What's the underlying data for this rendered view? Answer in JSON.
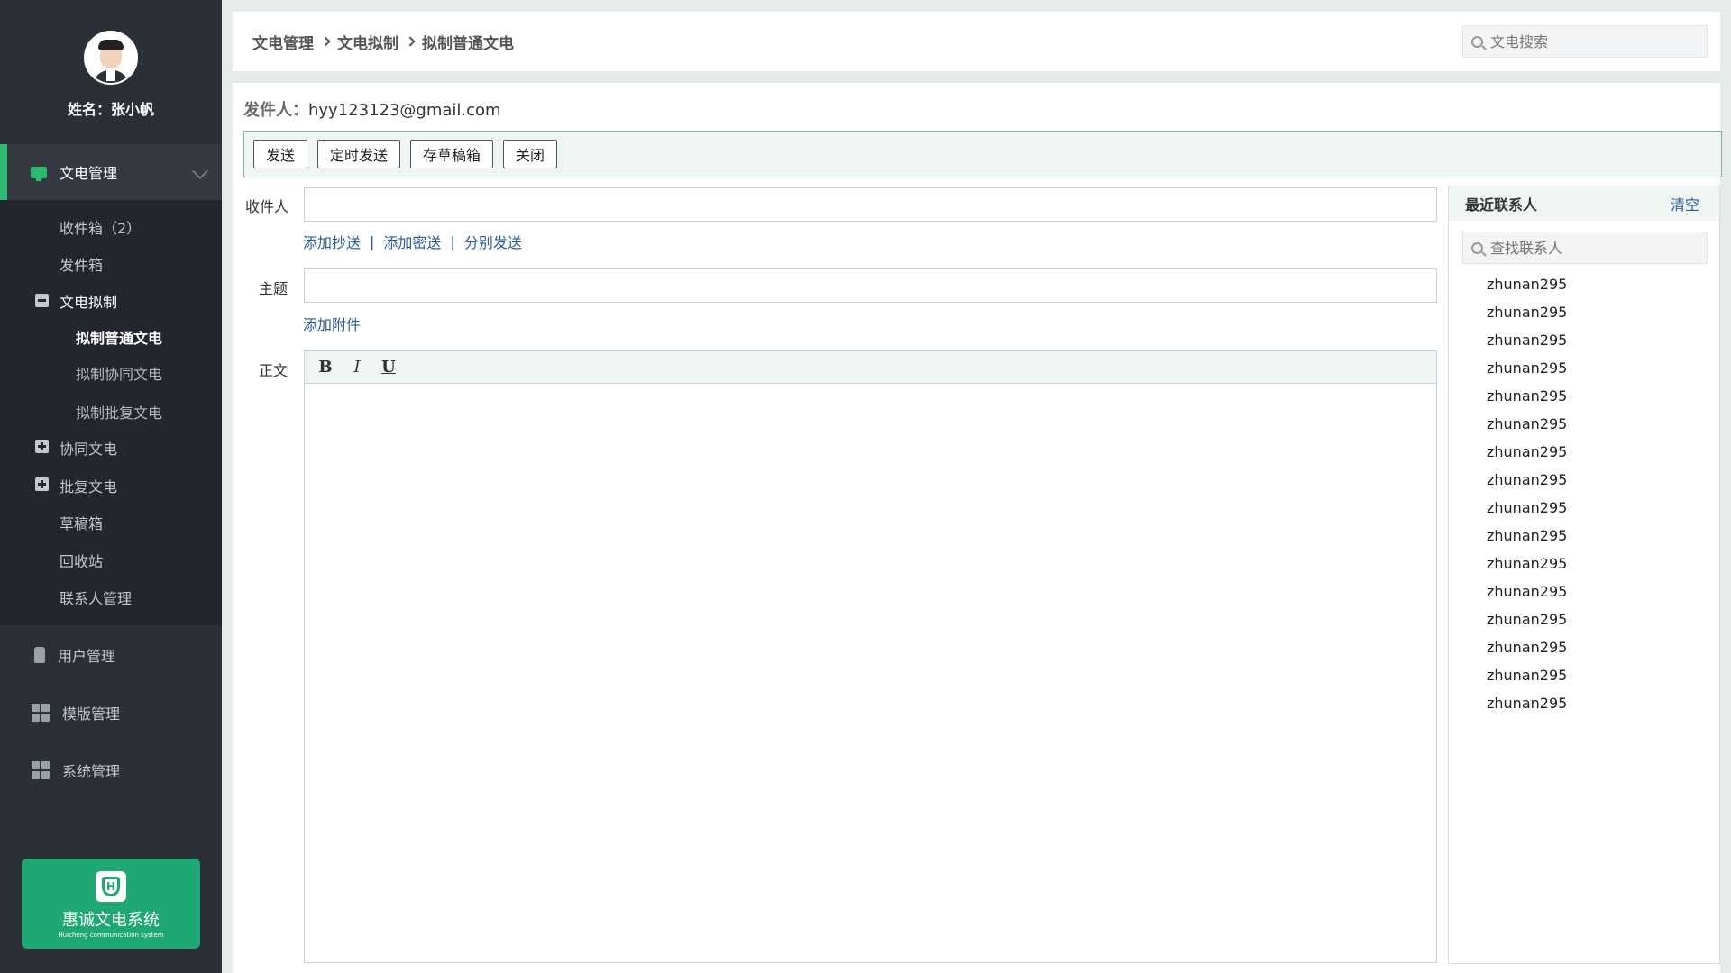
{
  "profile": {
    "name": "姓名：张小帆"
  },
  "nav": {
    "active": "文电管理",
    "sub": {
      "inbox": "收件箱（2）",
      "outbox": "发件箱",
      "draft_group": "文电拟制",
      "draft_normal": "拟制普通文电",
      "draft_collab": "拟制协同文电",
      "draft_approve": "拟制批复文电",
      "collab": "协同文电",
      "approve": "批复文电",
      "drafts": "草稿箱",
      "trash": "回收站",
      "contacts": "联系人管理"
    },
    "user_mgmt": "用户管理",
    "template_mgmt": "模版管理",
    "system_mgmt": "系统管理"
  },
  "brand": {
    "title": "惠诚文电系统",
    "subtitle": "Huicheng communication system"
  },
  "breadcrumb": [
    "文电管理",
    "文电拟制",
    "拟制普通文电"
  ],
  "top_search": {
    "placeholder": "文电搜索"
  },
  "sender": {
    "label": "发件人：",
    "value": "hyy123123@gmail.com"
  },
  "toolbar": {
    "send": "发送",
    "schedule": "定时发送",
    "save_draft": "存草稿箱",
    "close": "关闭"
  },
  "form": {
    "recipient_label": "收件人",
    "add_cc": "添加抄送",
    "add_bcc": "添加密送",
    "separate_send": "分别发送",
    "pipe": "|",
    "subject_label": "主题",
    "add_attachment": "添加附件",
    "body_label": "正文"
  },
  "editor": {
    "bold": "B",
    "italic": "I",
    "underline": "U"
  },
  "contacts": {
    "title": "最近联系人",
    "clear": "清空",
    "search_placeholder": "查找联系人",
    "list": [
      "zhunan295",
      "zhunan295",
      "zhunan295",
      "zhunan295",
      "zhunan295",
      "zhunan295",
      "zhunan295",
      "zhunan295",
      "zhunan295",
      "zhunan295",
      "zhunan295",
      "zhunan295",
      "zhunan295",
      "zhunan295",
      "zhunan295",
      "zhunan295"
    ]
  },
  "colors": {
    "sidebar": "#2b2f36",
    "accent": "#2eb872",
    "brand": "#1fa774",
    "link": "#2b5d98"
  }
}
